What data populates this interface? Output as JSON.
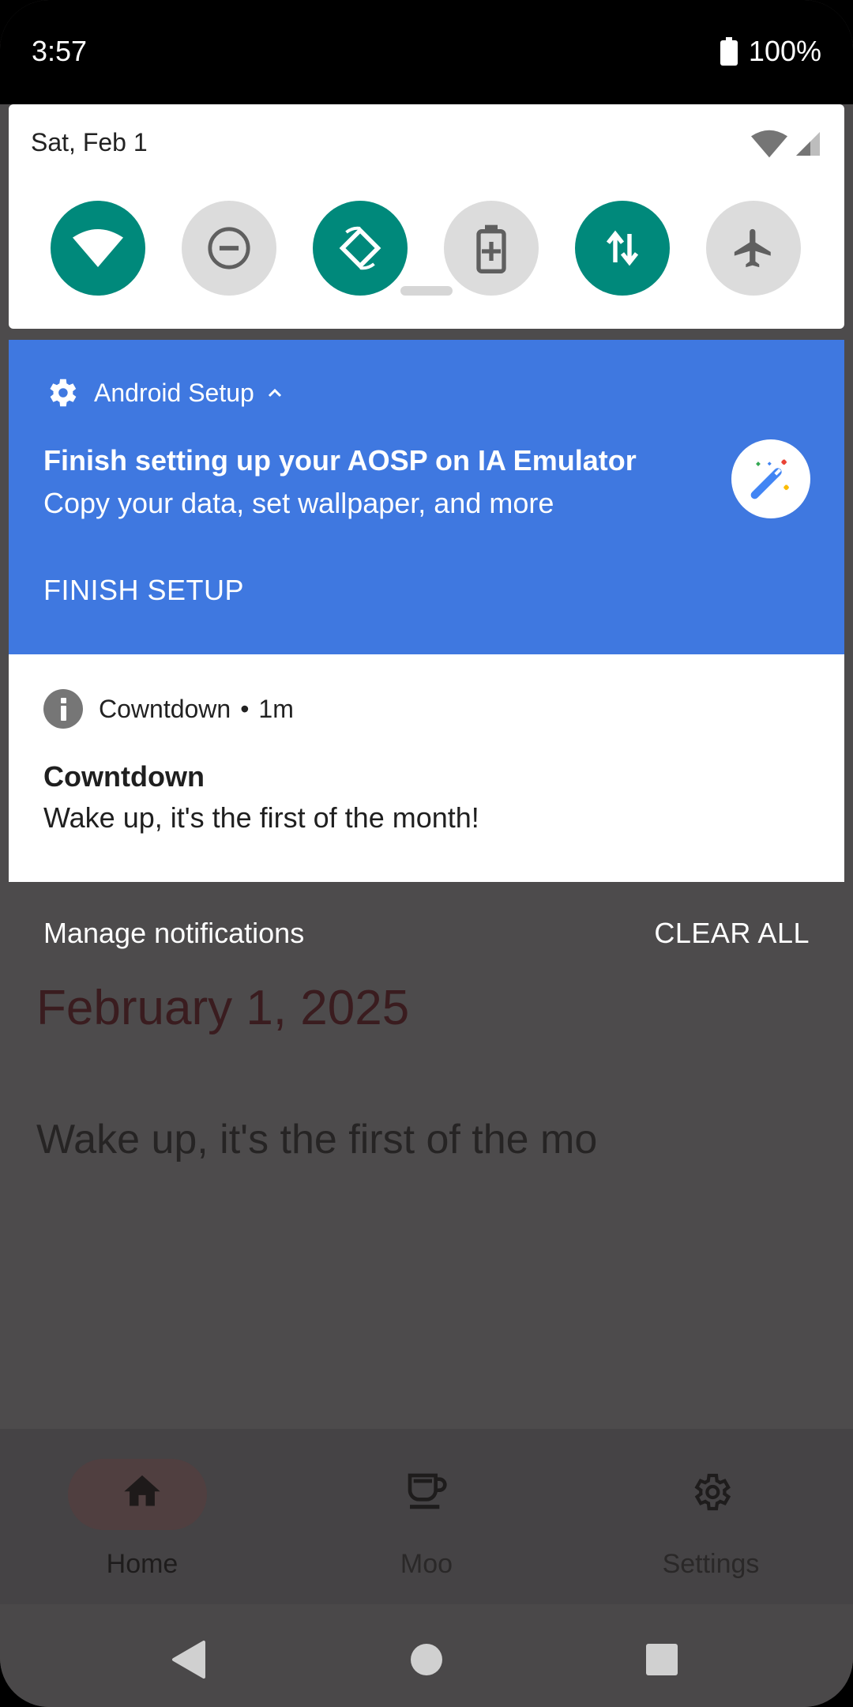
{
  "status_bar": {
    "time": "3:57",
    "battery": "100%"
  },
  "quick_settings": {
    "date": "Sat, Feb 1",
    "tiles": [
      {
        "name": "wifi",
        "state": "on",
        "icon": "wifi-icon"
      },
      {
        "name": "do-not-disturb",
        "state": "off",
        "icon": "dnd-icon"
      },
      {
        "name": "auto-rotate",
        "state": "on",
        "icon": "rotate-icon"
      },
      {
        "name": "battery-saver",
        "state": "off",
        "icon": "battery-saver-icon"
      },
      {
        "name": "mobile-data",
        "state": "on",
        "icon": "data-transfer-icon"
      },
      {
        "name": "airplane-mode",
        "state": "off",
        "icon": "airplane-icon"
      }
    ]
  },
  "notifications": [
    {
      "app": "Android Setup",
      "title": "Finish setting up your AOSP on IA Emulator",
      "text": "Copy your data, set wallpaper, and more",
      "action": "FINISH SETUP"
    },
    {
      "app": "Cowntdown",
      "time": "1m",
      "title": "Cowntdown",
      "text": "Wake up, it's the first of the month!"
    }
  ],
  "shade_footer": {
    "manage": "Manage notifications",
    "clear": "CLEAR ALL"
  },
  "background_app": {
    "date": "February 1, 2025",
    "message": "Wake up, it's the first of the mo",
    "nav": [
      {
        "label": "Home",
        "icon": "home-icon",
        "selected": true
      },
      {
        "label": "Moo",
        "icon": "cup-icon",
        "selected": false
      },
      {
        "label": "Settings",
        "icon": "gear-icon",
        "selected": false
      }
    ]
  },
  "colors": {
    "setup_notification": "#3f78e0",
    "tile_on": "#00897b",
    "tile_off": "#dcdcdc",
    "scrim": "#4d4b4c"
  }
}
